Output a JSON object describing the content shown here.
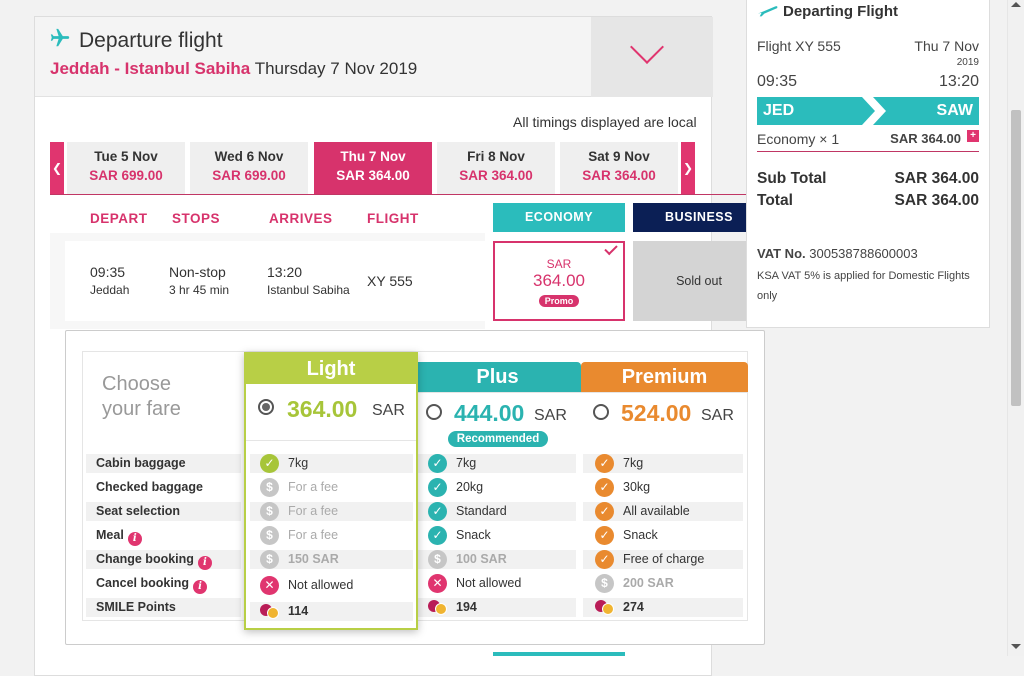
{
  "flight": {
    "title": "Departure flight",
    "route": "Jeddah - Istanbul Sabiha",
    "date": "Thursday 7 Nov 2019",
    "timing_note": "All timings displayed are local"
  },
  "date_tabs": [
    {
      "day": "Tue 5 Nov",
      "price": "SAR 699.00"
    },
    {
      "day": "Wed 6 Nov",
      "price": "SAR 699.00"
    },
    {
      "day": "Thu 7 Nov",
      "price": "SAR 364.00"
    },
    {
      "day": "Fri 8 Nov",
      "price": "SAR 364.00"
    },
    {
      "day": "Sat 9 Nov",
      "price": "SAR 364.00"
    }
  ],
  "nav": {
    "prev": "❮",
    "next": "❯"
  },
  "columns": {
    "depart": "DEPART",
    "stops": "STOPS",
    "arrives": "ARRIVES",
    "flight": "FLIGHT",
    "economy": "ECONOMY",
    "business": "BUSINESS"
  },
  "flight_row": {
    "dep_time": "09:35",
    "dep_city": "Jeddah",
    "stops": "Non-stop",
    "duration": "3 hr 45 min",
    "arr_time": "13:20",
    "arr_city": "Istanbul Sabiha",
    "flight_no": "XY 555",
    "eco_currency": "SAR",
    "eco_amount": "364.00",
    "eco_badge": "Promo",
    "business": "Sold out"
  },
  "fares": {
    "choose_line1": "Choose",
    "choose_line2": "your fare",
    "sar": "SAR",
    "recommended": "Recommended",
    "plans": [
      {
        "name": "Light",
        "price": "364.00",
        "color": "#b8cf46"
      },
      {
        "name": "Plus",
        "price": "444.00",
        "color": "#2bb3b0"
      },
      {
        "name": "Premium",
        "price": "524.00",
        "color": "#e98a2f"
      }
    ],
    "features": [
      {
        "label": "Cabin baggage",
        "info": false,
        "values": [
          "7kg",
          "7kg",
          "7kg"
        ]
      },
      {
        "label": "Checked baggage",
        "info": false,
        "values": [
          "For a fee",
          "20kg",
          "30kg"
        ]
      },
      {
        "label": "Seat selection",
        "info": false,
        "values": [
          "For a fee",
          "Standard",
          "All available"
        ]
      },
      {
        "label": "Meal",
        "info": true,
        "values": [
          "For a fee",
          "Snack",
          "Snack"
        ]
      },
      {
        "label": "Change booking",
        "info": true,
        "values": [
          "150 SAR",
          "100 SAR",
          "Free of charge"
        ]
      },
      {
        "label": "Cancel booking",
        "info": true,
        "values": [
          "Not allowed",
          "Not allowed",
          "200 SAR"
        ]
      },
      {
        "label": "SMILE Points",
        "info": false,
        "values": [
          "114",
          "194",
          "274"
        ]
      }
    ],
    "icon_dollar": "$",
    "icon_check": "✓",
    "icon_x": "✕",
    "info_glyph": "i"
  },
  "summary": {
    "title": "Departing Flight",
    "flight_no": "Flight XY 555",
    "date": "Thu 7 Nov",
    "year": "2019",
    "dep_time": "09:35",
    "arr_time": "13:20",
    "from": "JED",
    "to": "SAW",
    "class_line": "Economy × 1",
    "class_price": "SAR 364.00",
    "plus": "+",
    "subtotal_label": "Sub Total",
    "subtotal": "SAR 364.00",
    "total_label": "Total",
    "total": "SAR 364.00",
    "vat_label": "VAT No.",
    "vat_no": "300538788600003",
    "vat_note": "KSA VAT 5% is applied for Domestic Flights only"
  },
  "colors": {
    "brand": "#d7336c",
    "teal": "#2bbcbc",
    "navy": "#0b1f55",
    "light": "#b8cf46",
    "plus": "#2bb3b0",
    "premium": "#e98a2f"
  }
}
